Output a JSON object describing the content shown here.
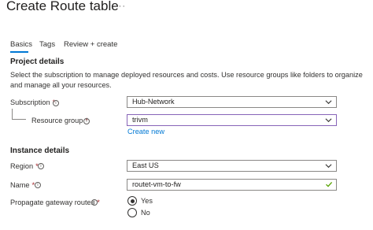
{
  "header": {
    "title": "Create Route table",
    "more_label": "···"
  },
  "tabs": [
    {
      "label": "Basics",
      "active": true
    },
    {
      "label": "Tags",
      "active": false
    },
    {
      "label": "Review + create",
      "active": false
    }
  ],
  "project_details": {
    "heading": "Project details",
    "description": "Select the subscription to manage deployed resources and costs. Use resource groups like folders to organize and manage all your resources.",
    "subscription": {
      "label": "Subscription",
      "required": "*",
      "value": "Hub-Network"
    },
    "resource_group": {
      "label": "Resource group",
      "required": "*",
      "value": "trivm",
      "create_new": "Create new"
    }
  },
  "instance_details": {
    "heading": "Instance details",
    "region": {
      "label": "Region",
      "required": "*",
      "value": "East US"
    },
    "name": {
      "label": "Name",
      "required": "*",
      "value": "routet-vm-to-fw"
    },
    "propagate": {
      "label": "Propagate gateway routes",
      "required": "*",
      "options": [
        "Yes",
        "No"
      ],
      "selected": "Yes"
    }
  },
  "colors": {
    "accent": "#0078d4",
    "focus_border": "#8764b8",
    "valid_check": "#57a300",
    "required": "#a4262c"
  },
  "icons": {
    "info": "info-icon",
    "chevron": "chevron-down-icon",
    "check": "checkmark-icon"
  }
}
